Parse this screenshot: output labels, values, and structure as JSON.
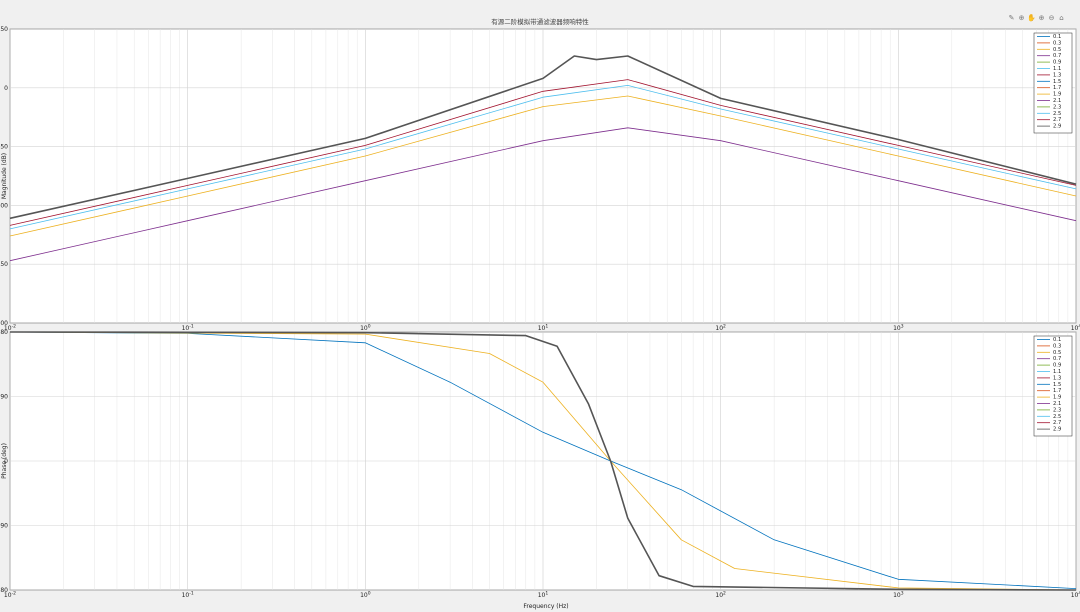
{
  "window": {
    "toolbar_icons": [
      "brush-icon",
      "data-tip-icon",
      "pan-icon",
      "zoom-in-icon",
      "zoom-out-icon",
      "home-icon"
    ],
    "toolbar_glyphs": [
      "✎",
      "⊕",
      "✋",
      "⊕",
      "⊖",
      "⌂"
    ]
  },
  "chart_data": [
    {
      "type": "line",
      "title": "有源二阶模拟带通滤波器频响特性",
      "xlabel": "",
      "ylabel": "Magnitude (dB)",
      "xscale": "log",
      "xlim": [
        0.01,
        10000
      ],
      "ylim": [
        -200,
        50
      ],
      "yticks": [
        50,
        0,
        -50,
        -100,
        -150,
        -200
      ],
      "xticks": [
        0.01,
        0.1,
        1,
        10,
        100,
        1000,
        10000
      ],
      "grid": true,
      "legend": {
        "placement": "top-right",
        "entries": [
          "0.1",
          "0.3",
          "0.5",
          "0.7",
          "0.9",
          "1.1",
          "1.3",
          "1.5",
          "1.7",
          "1.9",
          "2.1",
          "2.3",
          "2.5",
          "2.7",
          "2.9"
        ]
      },
      "series": [
        {
          "name": "0.1",
          "color": "#7e2f8e",
          "x": [
            0.01,
            0.1,
            1,
            10,
            30,
            100,
            1000,
            10000
          ],
          "y": [
            -147,
            -113,
            -79,
            -45,
            -34,
            -45,
            -79,
            -113
          ]
        },
        {
          "name": "0.3",
          "color": "#edb120",
          "x": [
            0.01,
            0.1,
            1,
            10,
            30,
            100,
            1000,
            10000
          ],
          "y": [
            -126,
            -92,
            -58,
            -16,
            -7,
            -24,
            -58,
            -92
          ]
        },
        {
          "name": "0.5",
          "color": "#4dbeee",
          "x": [
            0.01,
            0.1,
            1,
            10,
            30,
            100,
            1000,
            10000
          ],
          "y": [
            -120,
            -86,
            -52,
            -8,
            2,
            -18,
            -52,
            -86
          ]
        },
        {
          "name": "0.7",
          "color": "#a2142f",
          "x": [
            0.01,
            0.1,
            1,
            10,
            30,
            100,
            1000,
            10000
          ],
          "y": [
            -117,
            -83,
            -49,
            -3,
            7,
            -15,
            -49,
            -83
          ]
        },
        {
          "name": "2.9",
          "color": "#555555",
          "x": [
            0.01,
            0.1,
            1,
            10,
            15,
            20,
            30,
            100,
            1000,
            10000
          ],
          "y": [
            -111,
            -77,
            -43,
            8,
            27,
            24,
            27,
            -9,
            -44,
            -82
          ]
        }
      ]
    },
    {
      "type": "line",
      "title": "",
      "xlabel": "Frequency (Hz)",
      "ylabel": "Phase (deg)",
      "xscale": "log",
      "xlim": [
        0.01,
        10000
      ],
      "ylim": [
        -180,
        180
      ],
      "yticks": [
        180,
        90,
        0,
        -90,
        -180
      ],
      "xticks": [
        0.01,
        0.1,
        1,
        10,
        100,
        1000,
        10000
      ],
      "grid": true,
      "legend": {
        "placement": "top-right",
        "entries": [
          "0.1",
          "0.3",
          "0.5",
          "0.7",
          "0.9",
          "1.1",
          "1.3",
          "1.5",
          "1.7",
          "1.9",
          "2.1",
          "2.3",
          "2.5",
          "2.7",
          "2.9"
        ]
      },
      "series": [
        {
          "name": "0.1",
          "color": "#0072bd",
          "x": [
            0.01,
            0.1,
            1,
            3,
            10,
            24,
            60,
            200,
            1000,
            10000
          ],
          "y": [
            180,
            178,
            165,
            110,
            40,
            0,
            -40,
            -110,
            -165,
            -178
          ]
        },
        {
          "name": "0.3",
          "color": "#edb120",
          "x": [
            0.01,
            1,
            5,
            10,
            24,
            60,
            120,
            1000,
            10000
          ],
          "y": [
            180,
            177,
            150,
            110,
            0,
            -110,
            -150,
            -177,
            -180
          ]
        },
        {
          "name": "2.9",
          "color": "#555555",
          "x": [
            0.01,
            1,
            8,
            12,
            18,
            24,
            30,
            45,
            70,
            1000,
            10000
          ],
          "y": [
            180,
            179,
            175,
            160,
            80,
            0,
            -80,
            -160,
            -175,
            -179,
            -180
          ]
        }
      ]
    }
  ]
}
